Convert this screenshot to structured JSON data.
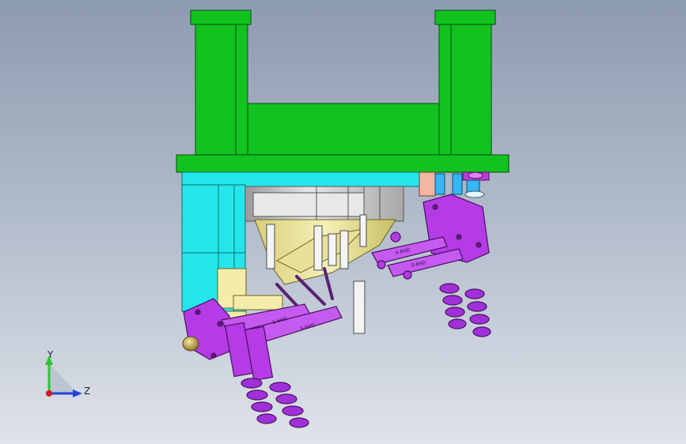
{
  "viewport": {
    "part_labels": [
      "S-6HD",
      "S-6HD",
      "S-6HD",
      "S-6HD"
    ]
  },
  "triad": {
    "y_label": "Y",
    "z_label": "Z"
  },
  "colors": {
    "background_top": "#8d9bb0",
    "background_bottom": "#dfe3ea",
    "frame_green": "#12c21f",
    "plate_cyan": "#24e6ea",
    "clamp_purple": "#b43be6",
    "block_cream": "#f2ecac",
    "steel_gray": "#cfcfcf",
    "pipe_blue": "#34b7f2",
    "triad_y": "#2ec43a",
    "triad_z": "#2442e0",
    "triad_x": "#d41a1a"
  }
}
